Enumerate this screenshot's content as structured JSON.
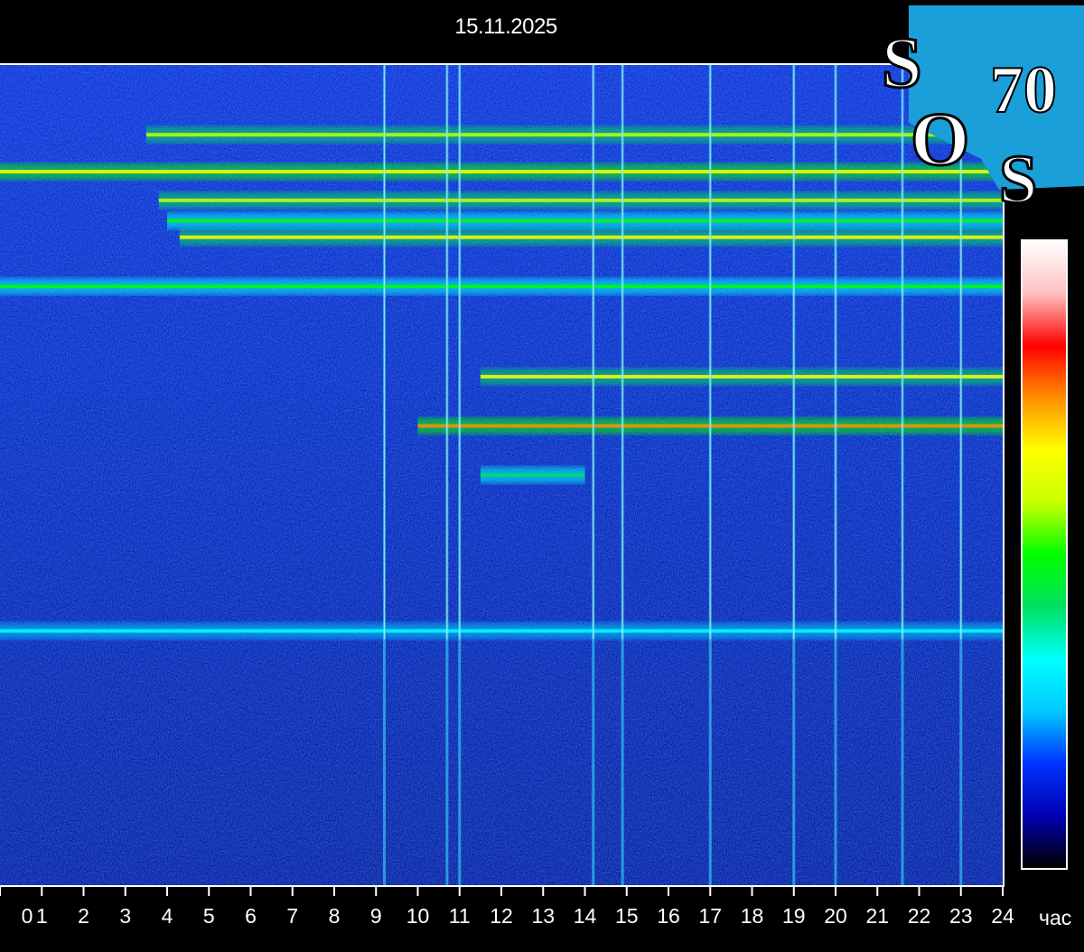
{
  "date": "15.11.2025",
  "logo": {
    "letters": [
      "S",
      "O",
      "S"
    ],
    "number": "70",
    "background": "#1a9fd8"
  },
  "chart_data": {
    "type": "heatmap",
    "title": "15.11.2025",
    "x_unit": "час",
    "xlim": [
      0,
      24
    ],
    "x_ticks": [
      "0",
      "1",
      "2",
      "3",
      "4",
      "5",
      "6",
      "7",
      "8",
      "9",
      "10",
      "11",
      "12",
      "13",
      "14",
      "15",
      "16",
      "17",
      "18",
      "19",
      "20",
      "21",
      "22",
      "23",
      "24"
    ],
    "colormap": [
      "#000000",
      "#0000b0",
      "#0033ff",
      "#00c8ff",
      "#00ffff",
      "#00e060",
      "#00ff00",
      "#c8ff00",
      "#ffff00",
      "#ff9000",
      "#ff0000",
      "#ffc0c0",
      "#ffffff"
    ],
    "horizontal_bands": [
      {
        "y_frac": 0.085,
        "start_h": 3.5,
        "end_h": 24,
        "intensity": 0.45
      },
      {
        "y_frac": 0.13,
        "start_h": 0,
        "end_h": 24,
        "intensity": 0.6
      },
      {
        "y_frac": 0.165,
        "start_h": 3.8,
        "end_h": 24,
        "intensity": 0.5
      },
      {
        "y_frac": 0.19,
        "start_h": 4,
        "end_h": 24,
        "intensity": 0.35
      },
      {
        "y_frac": 0.21,
        "start_h": 4.3,
        "end_h": 24,
        "intensity": 0.55
      },
      {
        "y_frac": 0.27,
        "start_h": 0,
        "end_h": 24,
        "intensity": 0.4
      },
      {
        "y_frac": 0.38,
        "start_h": 11.5,
        "end_h": 24,
        "intensity": 0.55
      },
      {
        "y_frac": 0.44,
        "start_h": 10,
        "end_h": 24,
        "intensity": 0.7
      },
      {
        "y_frac": 0.5,
        "start_h": 11.5,
        "end_h": 14,
        "intensity": 0.3
      },
      {
        "y_frac": 0.69,
        "start_h": 0,
        "end_h": 24,
        "intensity": 0.2
      }
    ],
    "vertical_spikes_h": [
      9.2,
      10.7,
      11.0,
      14.2,
      14.9,
      17.0,
      19.0,
      20.0,
      21.6,
      23.0
    ]
  }
}
